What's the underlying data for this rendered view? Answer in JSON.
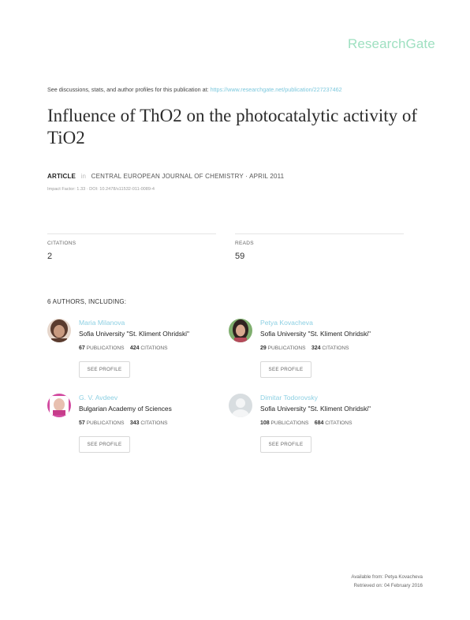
{
  "header": {
    "logo": "ResearchGate",
    "discuss_text": "See discussions, stats, and author profiles for this publication at:",
    "discuss_url": "https://www.researchgate.net/publication/227237462"
  },
  "paper": {
    "title": "Influence of ThO2 on the photocatalytic activity of TiO2",
    "type": "ARTICLE",
    "in": "in",
    "journal": "CENTRAL EUROPEAN JOURNAL OF CHEMISTRY · APRIL 2011",
    "impact": "Impact Factor: 1.33 · DOI: 10.2478/s11532-011-0089-4"
  },
  "stats": {
    "citations_label": "CITATIONS",
    "citations_value": "2",
    "reads_label": "READS",
    "reads_value": "59"
  },
  "authors_heading": "6 AUTHORS, INCLUDING:",
  "authors": [
    {
      "name": "Maria Milanova",
      "institution": "Sofia University \"St. Kliment Ohridski\"",
      "publications": "67",
      "citations": "424",
      "avatar_colors": [
        "#5a3b2e",
        "#c89a80"
      ]
    },
    {
      "name": "Petya Kovacheva",
      "institution": "Sofia University \"St. Kliment Ohridski\"",
      "publications": "29",
      "citations": "324",
      "avatar_colors": [
        "#2f2220",
        "#d9a98f"
      ]
    },
    {
      "name": "G. V. Avdeev",
      "institution": "Bulgarian Academy of Sciences",
      "publications": "57",
      "citations": "343",
      "avatar_colors": [
        "#d24aa0",
        "#e8c0b0"
      ]
    },
    {
      "name": "Dimitar Todorovsky",
      "institution": "Sofia University \"St. Kliment Ohridski\"",
      "publications": "108",
      "citations": "684",
      "avatar_colors": [
        "#d8dde0",
        "#f4f5f6"
      ]
    }
  ],
  "labels": {
    "publications": "PUBLICATIONS",
    "citations": "CITATIONS",
    "see_profile": "SEE PROFILE"
  },
  "footer": {
    "available": "Available from: Petya Kovacheva",
    "retrieved": "Retrieved on: 04 February 2016"
  }
}
